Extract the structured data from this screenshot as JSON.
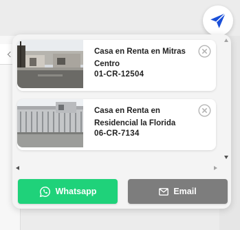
{
  "widget": {
    "toggle_icon": "paper-plane-icon",
    "accent_color": "#1a4fd8"
  },
  "listings": [
    {
      "title": "Casa en Renta en Mitras Centro",
      "code": "01-CR-12504",
      "remove_icon": "circle-x-icon"
    },
    {
      "title": "Casa en Renta en Residencial la Florida",
      "code": "06-CR-7134",
      "remove_icon": "circle-x-icon"
    }
  ],
  "actions": {
    "whatsapp_label": "Whatsapp",
    "whatsapp_icon": "whatsapp-icon",
    "whatsapp_color": "#1fd27a",
    "email_label": "Email",
    "email_icon": "envelope-icon",
    "email_color": "#7d7d7d"
  }
}
